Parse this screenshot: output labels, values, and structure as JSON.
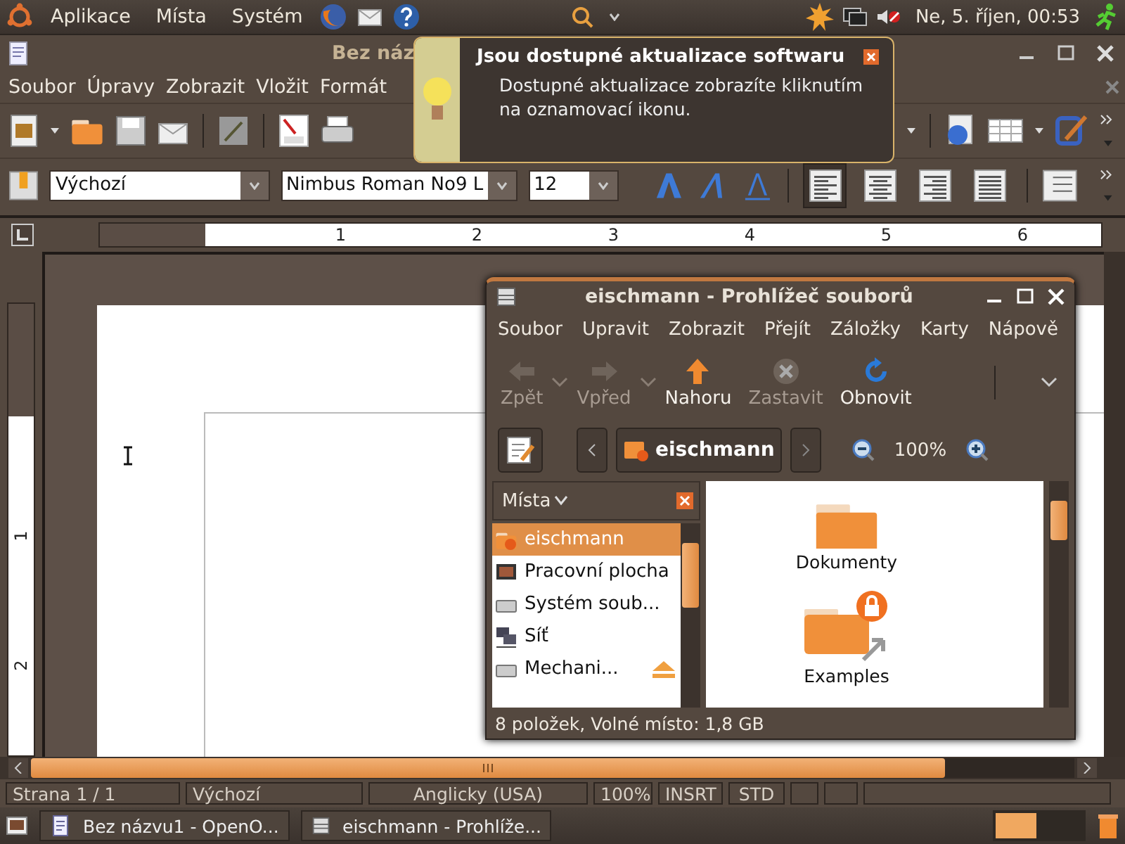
{
  "top_panel": {
    "menus": [
      "Aplikace",
      "Místa",
      "Systém"
    ],
    "clock": "Ne,  5. říjen, 00:53"
  },
  "writer": {
    "title": "Bez náz",
    "menus": [
      "Soubor",
      "Úpravy",
      "Zobrazit",
      "Vložit",
      "Formát"
    ],
    "style": "Výchozí",
    "font": "Nimbus Roman No9 L",
    "size": "12",
    "align_buttons": [
      {
        "kind": "left",
        "selected": true
      },
      {
        "kind": "center",
        "selected": false
      },
      {
        "kind": "right",
        "selected": false
      },
      {
        "kind": "justify",
        "selected": false
      }
    ],
    "ruler_numbers": [
      "1",
      "2",
      "3",
      "4",
      "5",
      "6"
    ],
    "vruler_numbers": [
      "1",
      "2"
    ],
    "status": [
      "Strana 1 / 1",
      "Výchozí",
      "Anglicky (USA)",
      "100%",
      "INSRT",
      "STD"
    ]
  },
  "notification": {
    "title": "Jsou dostupné aktualizace softwaru",
    "body": "Dostupné aktualizace zobrazíte kliknutím na oznamovací ikonu."
  },
  "file_browser": {
    "title": "eischmann - Prohlížeč souborů",
    "menus": [
      "Soubor",
      "Upravit",
      "Zobrazit",
      "Přejít",
      "Záložky",
      "Karty",
      "Nápově"
    ],
    "toolbar": [
      {
        "kind": "back",
        "label": "Zpět",
        "disabled": true
      },
      {
        "kind": "forward",
        "label": "Vpřed",
        "disabled": true
      },
      {
        "kind": "up",
        "label": "Nahoru",
        "disabled": false
      },
      {
        "kind": "stop",
        "label": "Zastavit",
        "disabled": true
      },
      {
        "kind": "reload",
        "label": "Obnovit",
        "disabled": false
      }
    ],
    "path": "eischmann",
    "zoom": "100%",
    "sidebar_title": "Místa",
    "places": [
      {
        "kind": "home",
        "label": "eischmann",
        "selected": true
      },
      {
        "kind": "desktop",
        "label": "Pracovní plocha",
        "selected": false
      },
      {
        "kind": "drive",
        "label": "Systém soub...",
        "selected": false
      },
      {
        "kind": "network",
        "label": "Síť",
        "selected": false
      },
      {
        "kind": "drive",
        "label": "Mechani...",
        "selected": false
      }
    ],
    "files": [
      {
        "kind": "folder",
        "label": "Dokumenty"
      },
      {
        "kind": "locked-link",
        "label": "Examples"
      }
    ],
    "status": "8 položek, Volné místo: 1,8 GB"
  },
  "taskbar": [
    {
      "kind": "document",
      "label": "Bez názvu1 - OpenO..."
    },
    {
      "kind": "file-manager",
      "label": "eischmann - Prohlíže..."
    }
  ]
}
